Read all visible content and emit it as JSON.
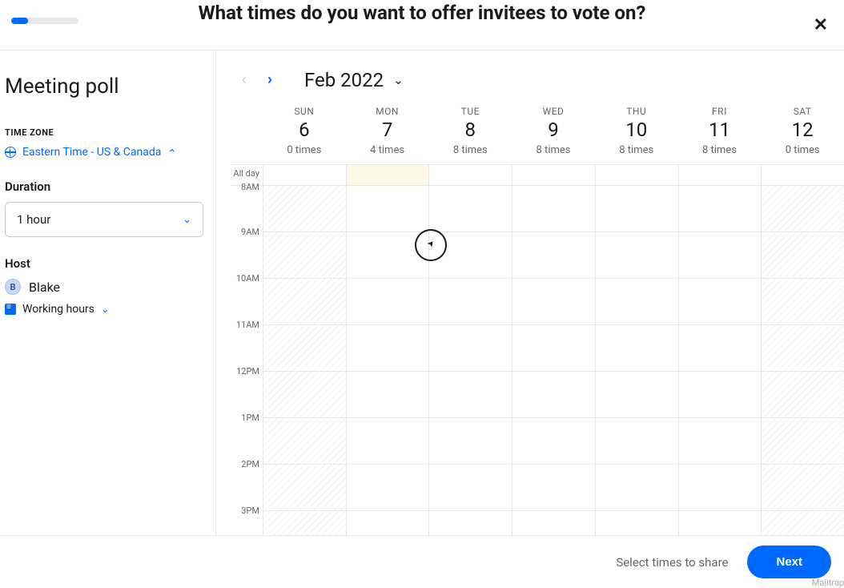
{
  "header": {
    "title": "What times do you want to offer invitees to vote on?"
  },
  "sidebar": {
    "title": "Meeting poll",
    "timezone_label": "TIME ZONE",
    "timezone_value": "Eastern Time - US & Canada",
    "duration_label": "Duration",
    "duration_value": "1 hour",
    "host_label": "Host",
    "host_name": "Blake",
    "host_initial": "B",
    "working_hours": "Working hours"
  },
  "calendar": {
    "month_label": "Feb 2022",
    "allday_label": "All day",
    "days": [
      {
        "dow": "SUN",
        "num": "6",
        "times": "0 times",
        "off": true,
        "today": false
      },
      {
        "dow": "MON",
        "num": "7",
        "times": "4 times",
        "off": false,
        "today": true
      },
      {
        "dow": "TUE",
        "num": "8",
        "times": "8 times",
        "off": false,
        "today": false
      },
      {
        "dow": "WED",
        "num": "9",
        "times": "8 times",
        "off": false,
        "today": false
      },
      {
        "dow": "THU",
        "num": "10",
        "times": "8 times",
        "off": false,
        "today": false
      },
      {
        "dow": "FRI",
        "num": "11",
        "times": "8 times",
        "off": false,
        "today": false
      },
      {
        "dow": "SAT",
        "num": "12",
        "times": "0 times",
        "off": true,
        "today": false
      }
    ],
    "hours": [
      "8AM",
      "9AM",
      "10AM",
      "11AM",
      "12PM",
      "1PM",
      "2PM",
      "3PM"
    ]
  },
  "footer": {
    "select_text": "Select times to share",
    "next_label": "Next",
    "watermark": "Mailtrap"
  }
}
